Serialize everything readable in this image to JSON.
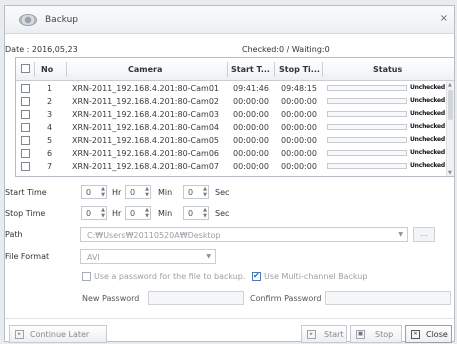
{
  "window": {
    "title": "Backup",
    "close_glyph": "×"
  },
  "info": {
    "date": "Date : 2016,05,23",
    "checked": "Checked:0 / Waiting:0"
  },
  "table": {
    "headers": [
      "No",
      "Camera",
      "Start T...",
      "Stop Ti...",
      "Status"
    ],
    "rows": [
      {
        "no": "1",
        "camera": "XRN-2011_192.168.4.201:80-Cam01",
        "start": "09:41:46",
        "stop": "09:48:15",
        "status": "Unchecked"
      },
      {
        "no": "2",
        "camera": "XRN-2011_192.168.4.201:80-Cam02",
        "start": "00:00:00",
        "stop": "00:00:00",
        "status": "Unchecked"
      },
      {
        "no": "3",
        "camera": "XRN-2011_192.168.4.201:80-Cam03",
        "start": "00:00:00",
        "stop": "00:00:00",
        "status": "Unchecked"
      },
      {
        "no": "4",
        "camera": "XRN-2011_192.168.4.201:80-Cam04",
        "start": "00:00:00",
        "stop": "00:00:00",
        "status": "Unchecked"
      },
      {
        "no": "5",
        "camera": "XRN-2011_192.168.4.201:80-Cam05",
        "start": "00:00:00",
        "stop": "00:00:00",
        "status": "Unchecked"
      },
      {
        "no": "6",
        "camera": "XRN-2011_192.168.4.201:80-Cam06",
        "start": "00:00:00",
        "stop": "00:00:00",
        "status": "Unchecked"
      },
      {
        "no": "7",
        "camera": "XRN-2011_192.168.4.201:80-Cam07",
        "start": "00:00:00",
        "stop": "00:00:00",
        "status": "Unchecked"
      }
    ]
  },
  "form": {
    "start_time_label": "Start Time",
    "stop_time_label": "Stop Time",
    "hr": "Hr",
    "min": "Min",
    "sec": "Sec",
    "start": {
      "hr": "0",
      "min": "0",
      "sec": "0"
    },
    "stop": {
      "hr": "0",
      "min": "0",
      "sec": "0"
    },
    "path_label": "Path",
    "path_value": "C:₩Users₩20110520A₩Desktop",
    "browse_label": "...",
    "file_format_label": "File Format",
    "file_format_value": "AVI",
    "use_password_label": "Use a password for the file to backup.",
    "use_password_checked": false,
    "multichannel_label": "Use Multi-channel Backup",
    "multichannel_checked": true,
    "new_password_label": "New Password",
    "confirm_password_label": "Confirm Password"
  },
  "footer": {
    "continue_later": "Continue Later",
    "start": "Start",
    "stop": "Stop",
    "close": "Close"
  }
}
